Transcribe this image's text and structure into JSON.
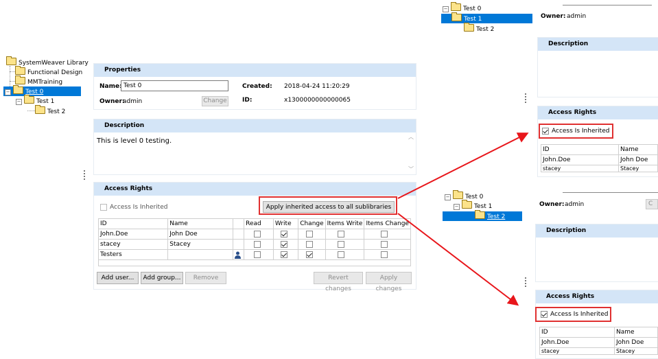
{
  "main": {
    "tree": [
      {
        "label": "SystemWeaver Library"
      },
      {
        "label": "Functional Design"
      },
      {
        "label": "MMTraining"
      },
      {
        "label": "Test 0"
      },
      {
        "label": "Test 1"
      },
      {
        "label": "Test 2"
      }
    ],
    "properties": {
      "header": "Properties",
      "name_label": "Name:",
      "name_value": "Test 0",
      "owner_label": "Owner:",
      "owner_value": "admin",
      "change_label": "Change",
      "created_label": "Created:",
      "created_value": "2018-04-24 11:20:29",
      "id_label": "ID:",
      "id_value": "x1300000000000065"
    },
    "description": {
      "header": "Description",
      "text": "This is level 0 testing."
    },
    "access": {
      "header": "Access Rights",
      "inherited_label": "Access Is Inherited",
      "apply_label": "Apply inherited access to all sublibraries",
      "columns": [
        "ID",
        "Name",
        "",
        "Read",
        "Write",
        "Change",
        "Items Write",
        "Items Change"
      ],
      "rows": [
        {
          "id": "John.Doe",
          "name": "John Doe"
        },
        {
          "id": "stacey",
          "name": "Stacey"
        },
        {
          "id": "Testers",
          "name": ""
        }
      ],
      "buttons": {
        "add_user": "Add user...",
        "add_group": "Add group...",
        "remove": "Remove",
        "revert": "Revert changes",
        "apply": "Apply changes"
      }
    }
  },
  "panel1": {
    "tree": [
      {
        "label": "Test 0"
      },
      {
        "label": "Test 1"
      },
      {
        "label": "Test 2"
      }
    ],
    "owner_label": "Owner:",
    "owner_value": "admin",
    "description_header": "Description",
    "access_header": "Access Rights",
    "inherited_label": "Access Is Inherited",
    "columns": [
      "ID",
      "Name"
    ],
    "rows": [
      {
        "id": "John.Doe",
        "name": "John Doe"
      },
      {
        "id": "stacey",
        "name": "Stacey"
      }
    ]
  },
  "panel2": {
    "tree": [
      {
        "label": "Test 0"
      },
      {
        "label": "Test 1"
      },
      {
        "label": "Test 2"
      }
    ],
    "owner_label": "Owner:",
    "owner_value": "admin",
    "change_partial": "C",
    "description_header": "Description",
    "access_header": "Access Rights",
    "inherited_label": "Access Is Inherited",
    "columns": [
      "ID",
      "Name"
    ],
    "rows": [
      {
        "id": "John.Doe",
        "name": "John Doe"
      },
      {
        "id": "stacey",
        "name": "Stacey"
      }
    ]
  },
  "colors": {
    "header": "#d4e5f7",
    "selection": "#0078d7",
    "annotation": "#e03030"
  }
}
